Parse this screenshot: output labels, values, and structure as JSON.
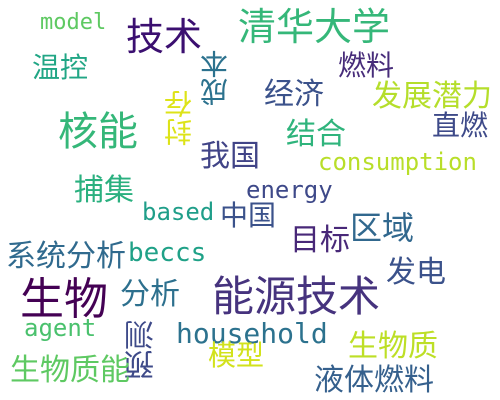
{
  "words": [
    {
      "text": "model",
      "color": "#5ec962"
    },
    {
      "text": "技术",
      "color": "#3b0f70"
    },
    {
      "text": "清华大学",
      "color": "#35b779"
    },
    {
      "text": "温控",
      "color": "#21a685"
    },
    {
      "text": "燃料",
      "color": "#472c7a"
    },
    {
      "text": "成本",
      "color": "#2c728e"
    },
    {
      "text": "经济",
      "color": "#3b528b"
    },
    {
      "text": "发展潜力",
      "color": "#b5de2b"
    },
    {
      "text": "核能",
      "color": "#35b779"
    },
    {
      "text": "封存",
      "color": "#dde318"
    },
    {
      "text": "结合",
      "color": "#2fb47c"
    },
    {
      "text": "直燃",
      "color": "#3e4a89"
    },
    {
      "text": "我国",
      "color": "#414487"
    },
    {
      "text": "consumption",
      "color": "#b8de29"
    },
    {
      "text": "捕集",
      "color": "#2ab07f"
    },
    {
      "text": "energy",
      "color": "#3e4989"
    },
    {
      "text": "based",
      "color": "#1f9e89"
    },
    {
      "text": "中国",
      "color": "#3b528b"
    },
    {
      "text": "区域",
      "color": "#31688e"
    },
    {
      "text": "目标",
      "color": "#482878"
    },
    {
      "text": "系统分析",
      "color": "#306a8e"
    },
    {
      "text": "beccs",
      "color": "#1fa187"
    },
    {
      "text": "发电",
      "color": "#3b528b"
    },
    {
      "text": "生物",
      "color": "#440154"
    },
    {
      "text": "分析",
      "color": "#2d708e"
    },
    {
      "text": "能源技术",
      "color": "#46337e"
    },
    {
      "text": "agent",
      "color": "#4ac16d"
    },
    {
      "text": "household",
      "color": "#2c728e"
    },
    {
      "text": "生物质",
      "color": "#bddf26"
    },
    {
      "text": "预测",
      "color": "#3e4a89"
    },
    {
      "text": "模型",
      "color": "#d2e21b"
    },
    {
      "text": "生物质能",
      "color": "#5ec962"
    },
    {
      "text": "液体燃料",
      "color": "#35608d"
    }
  ]
}
